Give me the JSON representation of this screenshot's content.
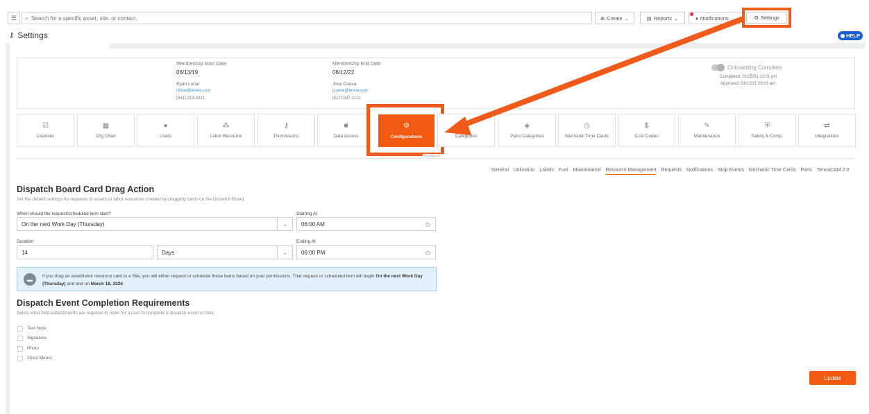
{
  "topbar": {
    "menu_icon": "sliders-icon",
    "search_placeholder": "Search for a specific asset, site, or contact.",
    "create_label": "Create",
    "reports_label": "Reports",
    "notifications_label": "Notifications",
    "settings_label": "Settings"
  },
  "page": {
    "title": "Settings",
    "help_label": "HELP"
  },
  "membership": {
    "start_label": "Membership Start Date",
    "start_date": "06/13/19",
    "start_contact_name": "Ryan Lunar",
    "start_contact_email": "rlunar@tenna.com",
    "start_contact_phone": "(941) 313-6021",
    "end_label": "Membership End Date",
    "end_date": "06/12/22",
    "end_contact_name": "Jose Cueva",
    "end_contact_email": "jcueva@tenna.com",
    "end_contact_phone": "(617) 947-2112",
    "onboarding_label": "Onboarding Complete",
    "completed_text": "Completed: 01/25/21 12:01 pm",
    "approved_text": "Approved: 03/12/21 09:03 am"
  },
  "tiles": [
    {
      "label": "Licenses",
      "icon": "license-icon",
      "glyph": "☑"
    },
    {
      "label": "Org Chart",
      "icon": "org-chart-icon",
      "glyph": "▦"
    },
    {
      "label": "Users",
      "icon": "user-icon",
      "glyph": "●"
    },
    {
      "label": "Labor Resource",
      "icon": "people-icon",
      "glyph": "⁂"
    },
    {
      "label": "Permissions",
      "icon": "key-icon",
      "glyph": "⚷"
    },
    {
      "label": "Data Access",
      "icon": "lock-icon",
      "glyph": "■"
    },
    {
      "label": "Configurations",
      "icon": "gear-icon",
      "glyph": "⚙"
    },
    {
      "label": "Categories",
      "icon": "tag-icon",
      "glyph": "◆"
    },
    {
      "label": "Parts Categories",
      "icon": "parts-icon",
      "glyph": "◈"
    },
    {
      "label": "Mechanic Time Cards",
      "icon": "clock-icon",
      "glyph": "◷"
    },
    {
      "label": "Cost Codes",
      "icon": "dollar-icon",
      "glyph": "$"
    },
    {
      "label": "Maintenance",
      "icon": "wrench-icon",
      "glyph": "✎"
    },
    {
      "label": "Safety & Comp.",
      "icon": "shield-icon",
      "glyph": "⛨"
    },
    {
      "label": "Integrations",
      "icon": "swap-icon",
      "glyph": "⇄"
    }
  ],
  "collapse_label": "Collapse",
  "subtabs": [
    "General",
    "Utilization",
    "Labels",
    "Fuel",
    "Maintenance",
    "Resource Management",
    "Requests",
    "Notifications",
    "Stop Events",
    "Mechanic Time Cards",
    "Parts",
    "TennaCAM 2.0"
  ],
  "active_subtab": "Resource Management",
  "drag_action": {
    "title": "Dispatch Board Card Drag Action",
    "description": "Set the default settings for requests of assets or labor resources created by dragging cards on the Dispatch Board.",
    "start_question": "When should the request/scheduled item start?",
    "start_value": "On the next Work Day (Thursday)",
    "starting_at_label": "Starting At",
    "starting_at_value": "06:00 AM",
    "duration_label": "Duration",
    "duration_value": "14",
    "duration_unit": "Days",
    "ending_at_label": "Ending At",
    "ending_at_value": "06:00 PM",
    "info_prefix": "If you drag an asset/labor resource card to a Site, you will either request or schedule those items based on your permissions. That request or scheduled item will begin ",
    "info_start_bold": "On the next Work Day (Thursday)",
    "info_middle": " and end on ",
    "info_end_bold": "March 19, 2026",
    "info_suffix": "."
  },
  "completion": {
    "title": "Dispatch Event Completion Requirements",
    "description": "Select what fields/attachments are required in order for a user to complete a dispatch event or task.",
    "options": [
      "Text Note",
      "Signature",
      "Photo",
      "Voice Memo"
    ]
  },
  "update_label": "Update",
  "colors": {
    "accent": "#f35a0f",
    "highlight": "#f05a1a",
    "help": "#1a5fd6",
    "info_bg": "#e2f1fb"
  }
}
